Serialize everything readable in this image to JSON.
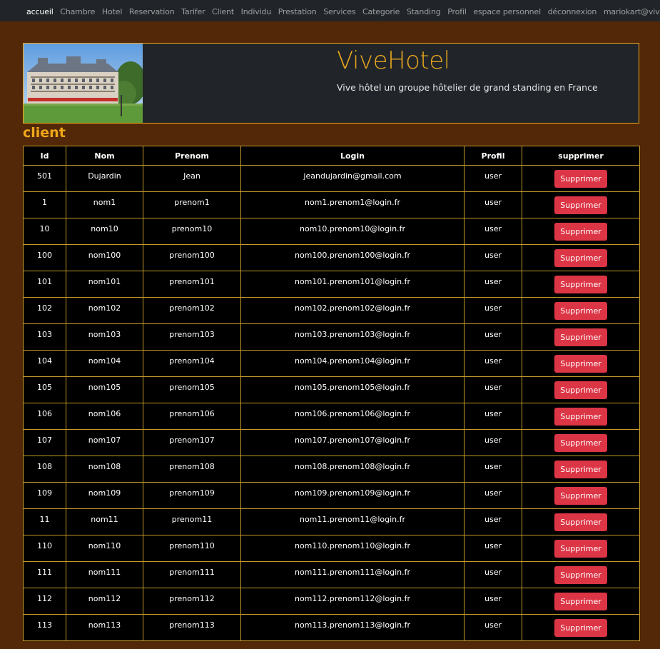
{
  "nav": {
    "items": [
      "accueil",
      "Chambre",
      "Hotel",
      "Reservation",
      "Tarifer",
      "Client",
      "Individu",
      "Prestation",
      "Services",
      "Categorie",
      "Standing",
      "Profil",
      "espace personnel",
      "déconnexion",
      "mariokart@vivehotel.fr"
    ]
  },
  "banner": {
    "title": "ViveHotel",
    "subtitle": "Vive hôtel un groupe hôtelier de grand standing en France"
  },
  "section": {
    "title": "client"
  },
  "table": {
    "headers": [
      "Id",
      "Nom",
      "Prenom",
      "Login",
      "Profil",
      "supprimer"
    ],
    "delete_label": "Supprimer",
    "rows": [
      [
        "501",
        "Dujardin",
        "Jean",
        "jeandujardin@gmail.com",
        "user"
      ],
      [
        "1",
        "nom1",
        "prenom1",
        "nom1.prenom1@login.fr",
        "user"
      ],
      [
        "10",
        "nom10",
        "prenom10",
        "nom10.prenom10@login.fr",
        "user"
      ],
      [
        "100",
        "nom100",
        "prenom100",
        "nom100.prenom100@login.fr",
        "user"
      ],
      [
        "101",
        "nom101",
        "prenom101",
        "nom101.prenom101@login.fr",
        "user"
      ],
      [
        "102",
        "nom102",
        "prenom102",
        "nom102.prenom102@login.fr",
        "user"
      ],
      [
        "103",
        "nom103",
        "prenom103",
        "nom103.prenom103@login.fr",
        "user"
      ],
      [
        "104",
        "nom104",
        "prenom104",
        "nom104.prenom104@login.fr",
        "user"
      ],
      [
        "105",
        "nom105",
        "prenom105",
        "nom105.prenom105@login.fr",
        "user"
      ],
      [
        "106",
        "nom106",
        "prenom106",
        "nom106.prenom106@login.fr",
        "user"
      ],
      [
        "107",
        "nom107",
        "prenom107",
        "nom107.prenom107@login.fr",
        "user"
      ],
      [
        "108",
        "nom108",
        "prenom108",
        "nom108.prenom108@login.fr",
        "user"
      ],
      [
        "109",
        "nom109",
        "prenom109",
        "nom109.prenom109@login.fr",
        "user"
      ],
      [
        "11",
        "nom11",
        "prenom11",
        "nom11.prenom11@login.fr",
        "user"
      ],
      [
        "110",
        "nom110",
        "prenom110",
        "nom110.prenom110@login.fr",
        "user"
      ],
      [
        "111",
        "nom111",
        "prenom111",
        "nom111.prenom111@login.fr",
        "user"
      ],
      [
        "112",
        "nom112",
        "prenom112",
        "nom112.prenom112@login.fr",
        "user"
      ],
      [
        "113",
        "nom113",
        "prenom113",
        "nom113.prenom113@login.fr",
        "user"
      ]
    ]
  },
  "colors": {
    "page_bg": "#532808",
    "navbar_bg": "#212529",
    "accent": "#f0a81a",
    "delete_button": "#dc3545"
  }
}
